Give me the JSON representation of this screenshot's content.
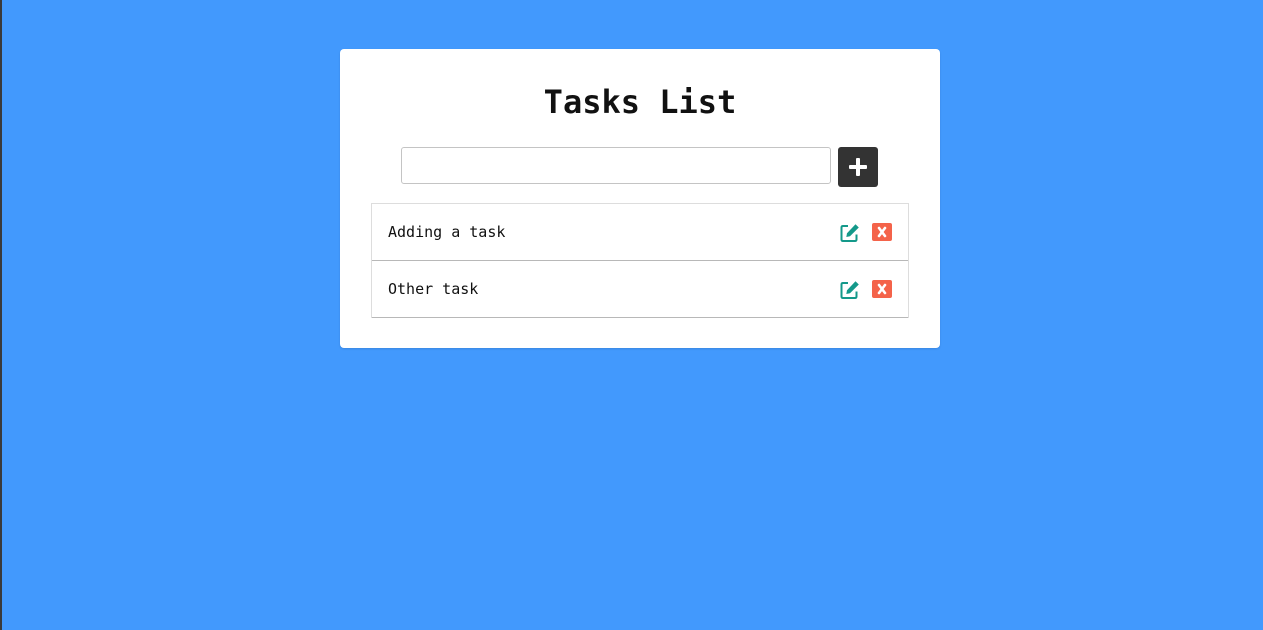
{
  "page": {
    "background": "#4299fd",
    "title": "Tasks List"
  },
  "new_task": {
    "value": "",
    "placeholder": "",
    "add_icon": "plus-icon"
  },
  "tasks": [
    {
      "text": "Adding a task",
      "edit_icon": "edit-icon",
      "delete_icon": "close-icon"
    },
    {
      "text": "Other task",
      "edit_icon": "edit-icon",
      "delete_icon": "close-icon"
    }
  ],
  "colors": {
    "accent_edit": "#14998a",
    "accent_delete": "#f4634a",
    "add_button": "#333333"
  }
}
